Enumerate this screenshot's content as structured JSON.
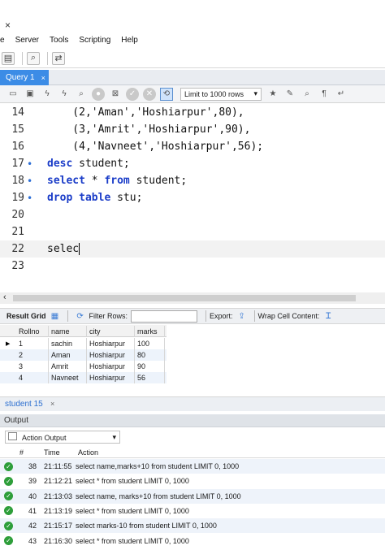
{
  "window": {
    "close_glyph": "×"
  },
  "menu": [
    "e",
    "Server",
    "Tools",
    "Scripting",
    "Help"
  ],
  "query_tab": {
    "label": "Query 1",
    "close": "×"
  },
  "editor_toolbar": {
    "limit_label": "Limit to 1000 rows"
  },
  "editor": {
    "lines": [
      {
        "num": "14",
        "marker": "",
        "parts": [
          [
            "",
            "    (2,'Aman','Hoshiarpur',80),"
          ]
        ]
      },
      {
        "num": "15",
        "marker": "",
        "parts": [
          [
            "",
            "    (3,'Amrit','Hoshiarpur',90),"
          ]
        ]
      },
      {
        "num": "16",
        "marker": "",
        "parts": [
          [
            "",
            "    (4,'Navneet','Hoshiarpur',56);"
          ]
        ]
      },
      {
        "num": "17",
        "marker": "•",
        "parts": [
          [
            "kw",
            "desc"
          ],
          [
            "",
            " student;"
          ]
        ]
      },
      {
        "num": "18",
        "marker": "•",
        "parts": [
          [
            "kw",
            "select"
          ],
          [
            "",
            " * "
          ],
          [
            "kw",
            "from"
          ],
          [
            "",
            " student;"
          ]
        ]
      },
      {
        "num": "19",
        "marker": "•",
        "parts": [
          [
            "kw",
            "drop table"
          ],
          [
            "",
            " stu;"
          ]
        ]
      },
      {
        "num": "20",
        "marker": "",
        "parts": []
      },
      {
        "num": "21",
        "marker": "",
        "parts": []
      },
      {
        "num": "22",
        "marker": "",
        "parts": [
          [
            "",
            "selec"
          ]
        ],
        "current": true
      },
      {
        "num": "23",
        "marker": "",
        "parts": []
      }
    ]
  },
  "result_toolbar": {
    "result_grid": "Result Grid",
    "filter_rows": "Filter Rows:",
    "export": "Export:",
    "wrap": "Wrap Cell Content:"
  },
  "result_grid": {
    "columns": [
      "Rollno",
      "name",
      "city",
      "marks"
    ],
    "rows": [
      [
        "1",
        "sachin",
        "Hoshiarpur",
        "100"
      ],
      [
        "2",
        "Aman",
        "Hoshiarpur",
        "80"
      ],
      [
        "3",
        "Amrit",
        "Hoshiarpur",
        "90"
      ],
      [
        "4",
        "Navneet",
        "Hoshiarpur",
        "56"
      ]
    ]
  },
  "result_tab": {
    "label": "student 15",
    "close": "×"
  },
  "output": {
    "header": "Output",
    "selector": "Action Output",
    "columns": [
      "#",
      "Time",
      "Action"
    ],
    "rows": [
      [
        "38",
        "21:11:55",
        "select name,marks+10 from student LIMIT 0, 1000"
      ],
      [
        "39",
        "21:12:21",
        "select * from student LIMIT 0, 1000"
      ],
      [
        "40",
        "21:13:03",
        "select name, marks+10 from student LIMIT 0, 1000"
      ],
      [
        "41",
        "21:13:19",
        "select * from student LIMIT 0, 1000"
      ],
      [
        "42",
        "21:15:17",
        "select marks-10 from student LIMIT 0, 1000"
      ],
      [
        "43",
        "21:16:30",
        "select * from student LIMIT 0, 1000"
      ]
    ]
  },
  "colors": {
    "accent": "#3c8ce6",
    "keyword": "#1a3cc8",
    "ok": "#2e9e3a"
  }
}
